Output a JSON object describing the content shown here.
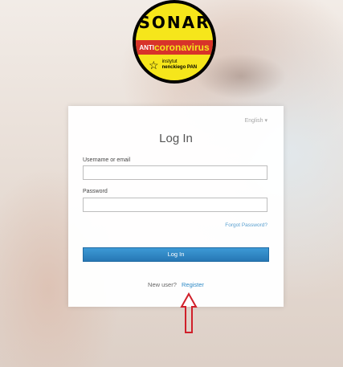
{
  "logo": {
    "title": "SONAR",
    "strip_prefix": "ANTI",
    "strip_main": "coronavirus",
    "sub_line1": "instytut",
    "sub_line2": "nenckiego PAN"
  },
  "login": {
    "language": "English ▾",
    "title": "Log In",
    "username_label": "Username or email",
    "username_value": "",
    "password_label": "Password",
    "password_value": "",
    "forgot_link": "Forgot Password?",
    "login_button": "Log In",
    "new_user_text": "New user?",
    "register_link": "Register"
  },
  "colors": {
    "accent": "#2e8ac6",
    "arrow": "#d0202a",
    "badge_yellow": "#f6e61b"
  }
}
